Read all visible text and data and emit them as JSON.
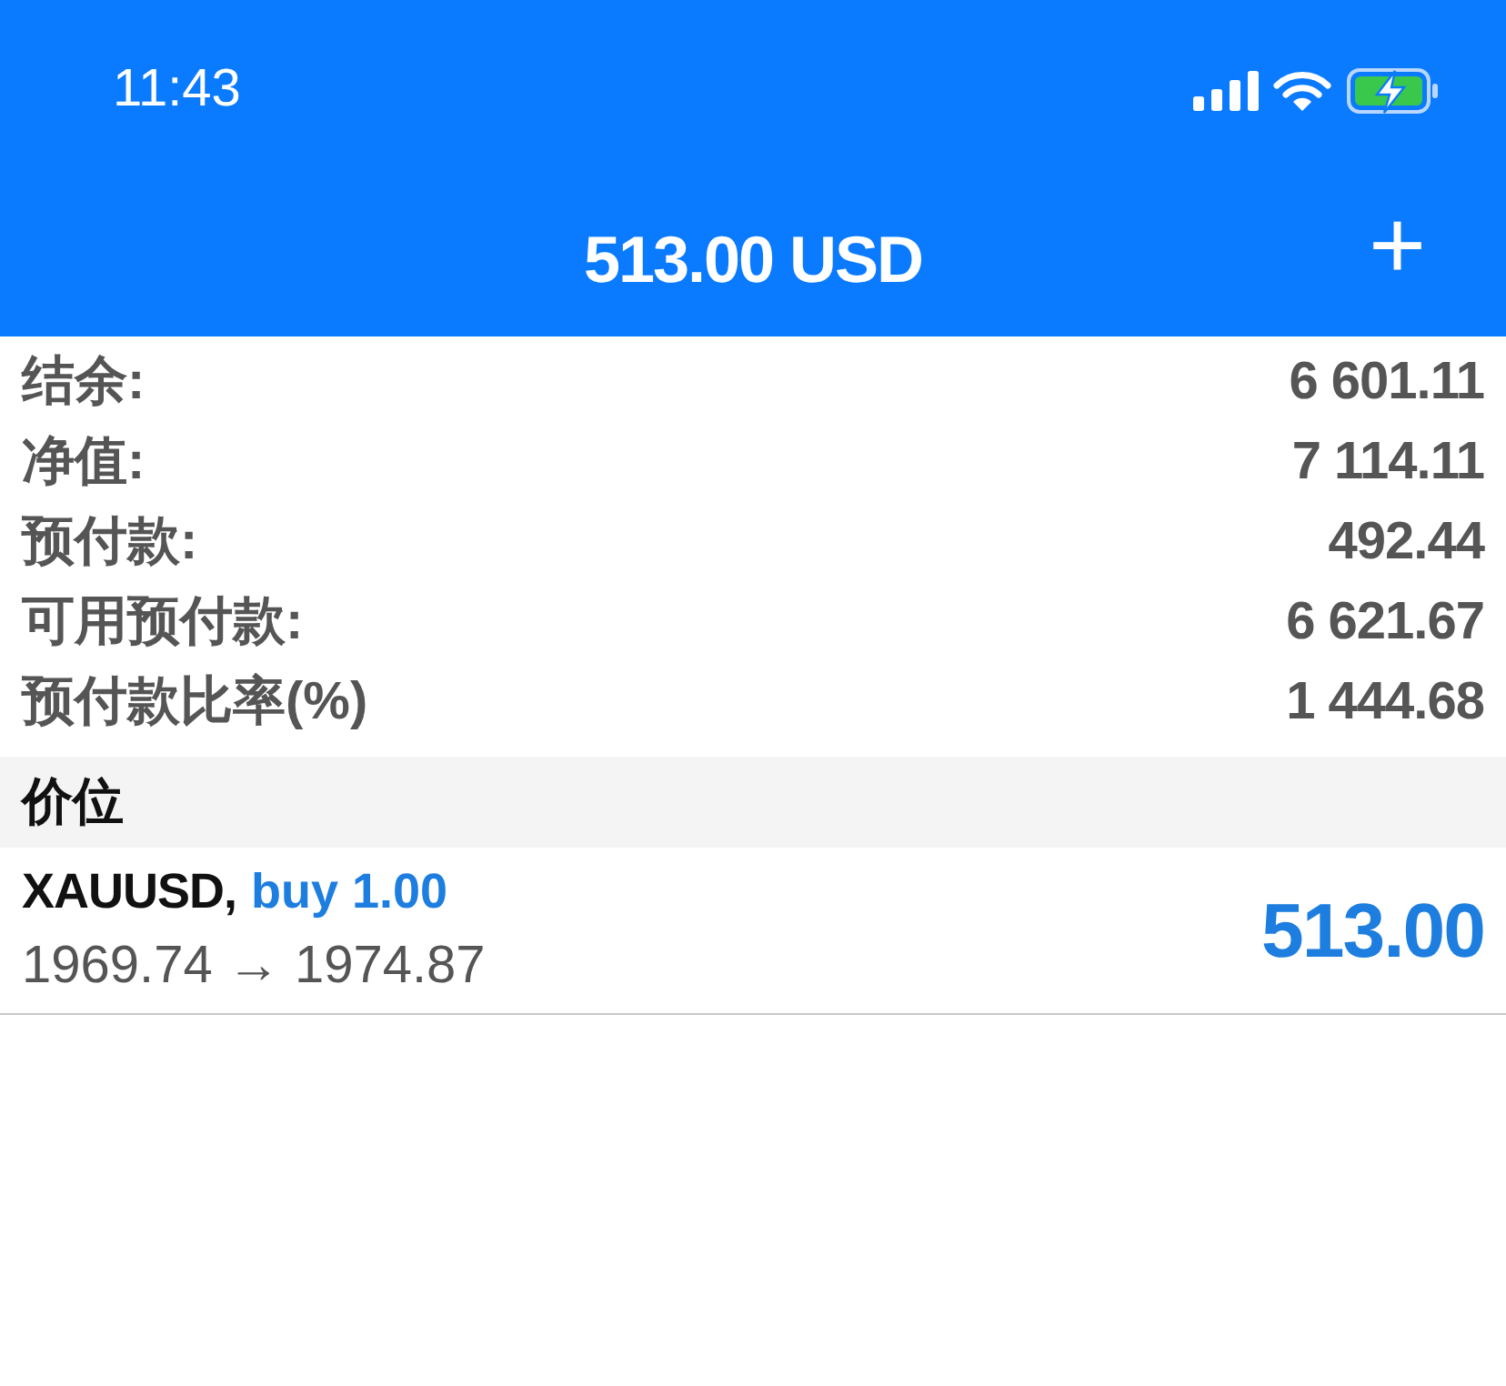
{
  "status_bar": {
    "time": "11:43"
  },
  "header": {
    "title": "513.00 USD",
    "add_button": "+"
  },
  "summary": [
    {
      "label": "结余:",
      "value": "6 601.11"
    },
    {
      "label": "净值:",
      "value": "7 114.11"
    },
    {
      "label": "预付款:",
      "value": "492.44"
    },
    {
      "label": "可用预付款:",
      "value": "6 621.67"
    },
    {
      "label": "预付款比率(%)",
      "value": "1 444.68"
    }
  ],
  "section": {
    "title": "价位"
  },
  "positions": [
    {
      "symbol": "XAUUSD,",
      "order": "buy 1.00",
      "prices": "1969.74 → 1974.87",
      "profit": "513.00"
    }
  ]
}
